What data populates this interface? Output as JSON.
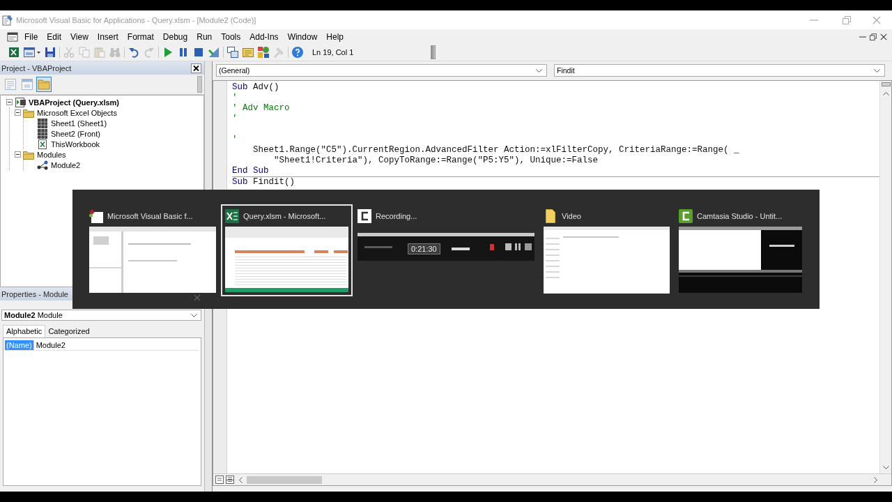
{
  "window": {
    "title": "Microsoft Visual Basic for Applications - Query.xlsm - [Module2 (Code)]",
    "active": false
  },
  "menu": [
    {
      "label": "File"
    },
    {
      "label": "Edit"
    },
    {
      "label": "View"
    },
    {
      "label": "Insert"
    },
    {
      "label": "Format"
    },
    {
      "label": "Debug"
    },
    {
      "label": "Run"
    },
    {
      "label": "Tools"
    },
    {
      "label": "Add-Ins"
    },
    {
      "label": "Window"
    },
    {
      "label": "Help"
    }
  ],
  "toolbar": {
    "groups": [
      {
        "buttons": [
          {
            "kind": "excel",
            "disabled": false
          },
          {
            "kind": "userform",
            "disabled": false
          },
          {
            "kind": "save",
            "disabled": false
          }
        ]
      },
      {
        "buttons": [
          {
            "kind": "cut",
            "disabled": true
          },
          {
            "kind": "copy",
            "disabled": true
          },
          {
            "kind": "paste",
            "disabled": true
          },
          {
            "kind": "find",
            "disabled": true
          }
        ]
      },
      {
        "buttons": [
          {
            "kind": "undo",
            "disabled": false
          },
          {
            "kind": "redo",
            "disabled": true
          }
        ]
      },
      {
        "buttons": [
          {
            "kind": "run",
            "disabled": false
          },
          {
            "kind": "break",
            "disabled": false
          },
          {
            "kind": "reset",
            "disabled": false
          },
          {
            "kind": "design",
            "disabled": false
          }
        ]
      },
      {
        "buttons": [
          {
            "kind": "project",
            "disabled": false
          },
          {
            "kind": "properties",
            "disabled": false
          },
          {
            "kind": "browser",
            "disabled": false
          },
          {
            "kind": "toolbox",
            "disabled": true
          }
        ]
      },
      {
        "buttons": [
          {
            "kind": "help",
            "disabled": false
          }
        ]
      }
    ],
    "position": "Ln 19, Col 1"
  },
  "project": {
    "title": "Project - VBAProject",
    "view_buttons": [
      {
        "kind": "code",
        "selected": false,
        "disabled": true
      },
      {
        "kind": "object",
        "selected": false,
        "disabled": true
      },
      {
        "kind": "folders",
        "selected": true,
        "disabled": false
      }
    ],
    "tree": [
      {
        "label": "VBAProject (Query.xlsm)",
        "kind": "project",
        "expanded": true,
        "children": [
          {
            "label": "Microsoft Excel Objects",
            "kind": "folder",
            "expanded": true,
            "children": [
              {
                "label": "Sheet1 (Sheet1)",
                "kind": "sheet"
              },
              {
                "label": "Sheet2 (Front)",
                "kind": "sheet"
              },
              {
                "label": "ThisWorkbook",
                "kind": "workbook"
              }
            ]
          },
          {
            "label": "Modules",
            "kind": "folder",
            "expanded": true,
            "children": [
              {
                "label": "Module2",
                "kind": "module"
              }
            ]
          }
        ]
      }
    ]
  },
  "properties": {
    "title": "Properties - Module",
    "selector": "**Module2** Module",
    "tabs": [
      {
        "label": "Alphabetic",
        "selected": true
      },
      {
        "label": "Categorized",
        "selected": false
      }
    ],
    "rows": [
      {
        "name": "(Name)",
        "value": "Module2",
        "selected": true
      }
    ]
  },
  "code_window": {
    "object": "(General)",
    "procedure": "Findit",
    "procedures": [
      {
        "lines": [
          {
            "kind": "code",
            "segments": [
              {
                "text": "Sub",
                "kind": "keyword"
              },
              {
                "text": " Adv()",
                "kind": "plain"
              }
            ]
          },
          {
            "kind": "code",
            "segments": [
              {
                "text": "'",
                "kind": "comment"
              }
            ]
          },
          {
            "kind": "code",
            "segments": [
              {
                "text": "' Adv Macro",
                "kind": "comment"
              }
            ]
          },
          {
            "kind": "code",
            "segments": [
              {
                "text": "'",
                "kind": "comment"
              }
            ]
          },
          {
            "kind": "blank"
          },
          {
            "kind": "code",
            "segments": [
              {
                "text": "'",
                "kind": "comment"
              }
            ]
          },
          {
            "kind": "code",
            "segments": [
              {
                "text": "    Sheet1.Range(\"C5\").CurrentRegion.AdvancedFilter Action:=xlFilterCopy, CriteriaRange:=Range( _",
                "kind": "plain"
              }
            ]
          },
          {
            "kind": "code",
            "segments": [
              {
                "text": "        \"Sheet1!Criteria\"), CopyToRange:=Range(\"P5:Y5\"), Unique:=False",
                "kind": "plain"
              }
            ]
          },
          {
            "kind": "code",
            "segments": [
              {
                "text": "End Sub",
                "kind": "keyword"
              }
            ]
          }
        ]
      },
      {
        "lines": [
          {
            "kind": "code",
            "segments": [
              {
                "text": "Sub",
                "kind": "keyword"
              },
              {
                "text": " Findit()",
                "kind": "plain"
              }
            ]
          }
        ]
      }
    ]
  },
  "switcher": {
    "windows": [
      {
        "title": "Microsoft Visual Basic f...",
        "kind": "vba",
        "selected": false
      },
      {
        "title": "Query.xlsm - Microsoft...",
        "kind": "excel",
        "selected": true
      },
      {
        "title": "Recording...",
        "kind": "recorder",
        "selected": false,
        "timer": "0:21:30"
      },
      {
        "title": "Video",
        "kind": "folder",
        "selected": false
      },
      {
        "title": "Camtasia Studio - Untit...",
        "kind": "camtasia",
        "selected": false
      }
    ]
  }
}
